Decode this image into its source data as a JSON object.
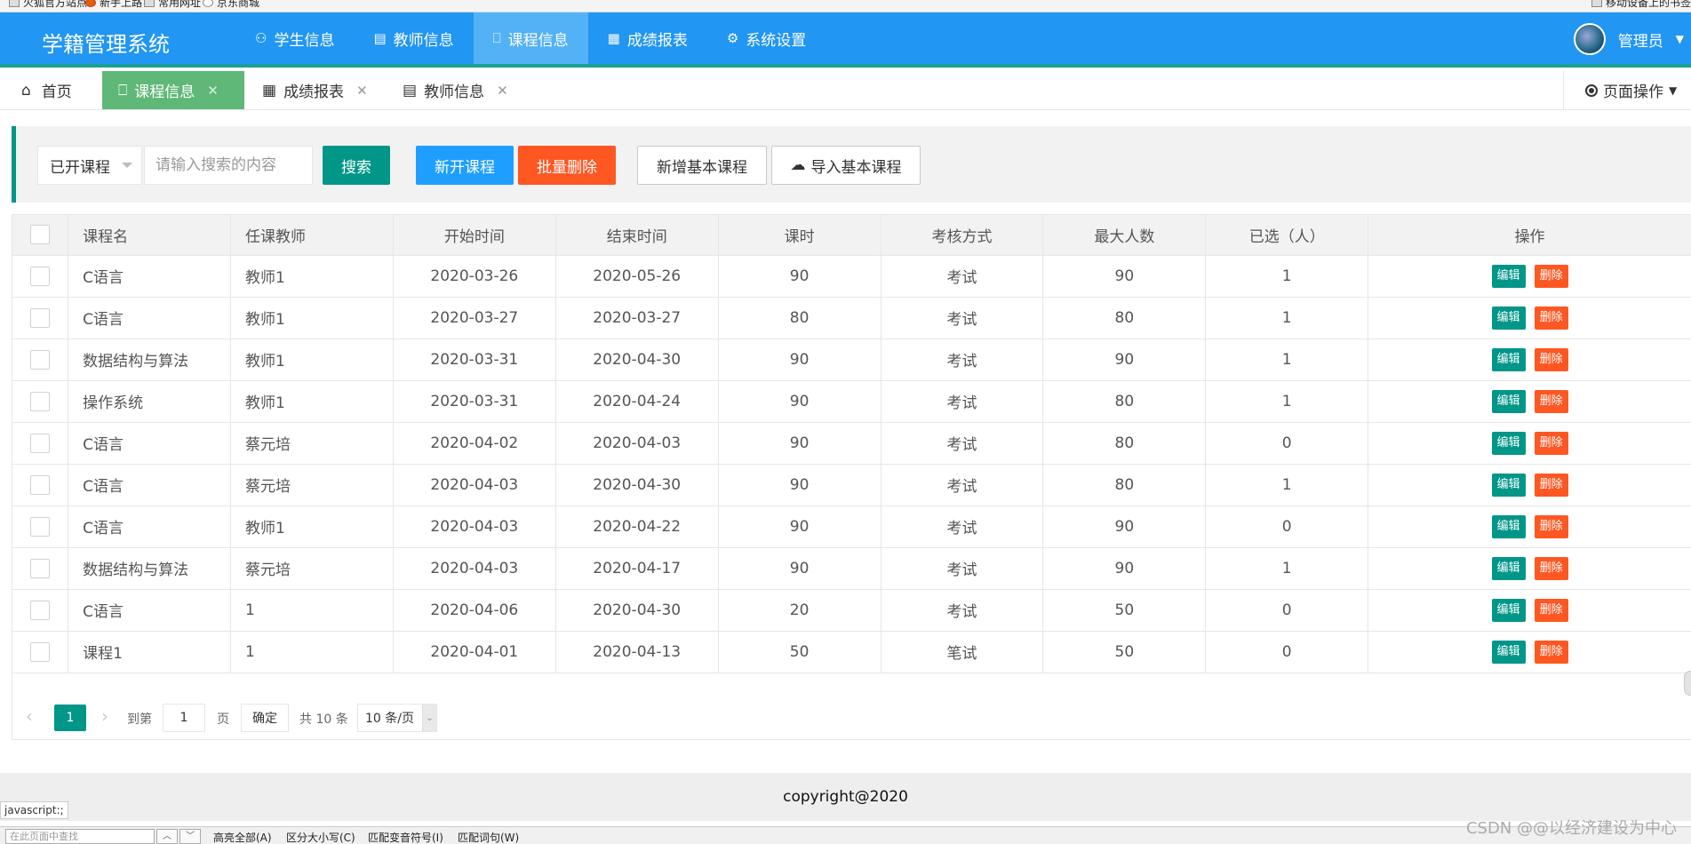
{
  "browser": {
    "bookmarks": [
      "火狐官方站点",
      "新手上路",
      "常用网址",
      "京东商城"
    ],
    "right_bookmark": "移动设备上的书签"
  },
  "header": {
    "logo": "学籍管理系统",
    "nav": [
      {
        "label": "学生信息",
        "icon": "users-icon"
      },
      {
        "label": "教师信息",
        "icon": "clipboard-icon"
      },
      {
        "label": "课程信息",
        "icon": "book-icon"
      },
      {
        "label": "成绩报表",
        "icon": "table-icon"
      },
      {
        "label": "系统设置",
        "icon": "gear-icon"
      }
    ],
    "active_nav": "课程信息",
    "user": "管理员"
  },
  "tabs": {
    "items": [
      {
        "label": "首页",
        "icon": "home-icon"
      },
      {
        "label": "课程信息",
        "icon": "book-icon"
      },
      {
        "label": "成绩报表",
        "icon": "table-icon"
      },
      {
        "label": "教师信息",
        "icon": "clipboard-icon"
      }
    ],
    "active": "课程信息",
    "page_op": "页面操作"
  },
  "toolbar": {
    "select_value": "已开课程",
    "search_placeholder": "请输入搜索的内容",
    "search_btn": "搜索",
    "new_course_btn": "新开课程",
    "batch_delete_btn": "批量删除",
    "add_basic_btn": "新增基本课程",
    "import_basic_btn": "导入基本课程"
  },
  "table": {
    "headers": [
      "课程名",
      "任课教师",
      "开始时间",
      "结束时间",
      "课时",
      "考核方式",
      "最大人数",
      "已选（人）",
      "操作"
    ],
    "rows": [
      [
        "C语言",
        "教师1",
        "2020-03-26",
        "2020-05-26",
        "90",
        "考试",
        "90",
        "1"
      ],
      [
        "C语言",
        "教师1",
        "2020-03-27",
        "2020-03-27",
        "80",
        "考试",
        "80",
        "1"
      ],
      [
        "数据结构与算法",
        "教师1",
        "2020-03-31",
        "2020-04-30",
        "90",
        "考试",
        "90",
        "1"
      ],
      [
        "操作系统",
        "教师1",
        "2020-03-31",
        "2020-04-24",
        "90",
        "考试",
        "80",
        "1"
      ],
      [
        "C语言",
        "蔡元培",
        "2020-04-02",
        "2020-04-03",
        "90",
        "考试",
        "80",
        "0"
      ],
      [
        "C语言",
        "蔡元培",
        "2020-04-03",
        "2020-04-30",
        "90",
        "考试",
        "80",
        "1"
      ],
      [
        "C语言",
        "教师1",
        "2020-04-03",
        "2020-04-22",
        "90",
        "考试",
        "90",
        "0"
      ],
      [
        "数据结构与算法",
        "蔡元培",
        "2020-04-03",
        "2020-04-17",
        "90",
        "考试",
        "90",
        "1"
      ],
      [
        "C语言",
        "1",
        "2020-04-06",
        "2020-04-30",
        "20",
        "考试",
        "50",
        "0"
      ],
      [
        "课程1",
        "1",
        "2020-04-01",
        "2020-04-13",
        "50",
        "笔试",
        "50",
        "0"
      ]
    ],
    "edit_label": "编辑",
    "delete_label": "删除"
  },
  "pager": {
    "current": "1",
    "goto_label": "到第",
    "page_input": "1",
    "page_unit": "页",
    "confirm": "确定",
    "total": "共 10 条",
    "page_size": "10 条/页"
  },
  "footer": {
    "copyright": "copyright@2020",
    "status_url": "javascript:;"
  },
  "findbar": {
    "placeholder": "在此页面中查找",
    "options": [
      "高亮全部(A)",
      "区分大小写(C)",
      "匹配变音符号(I)",
      "匹配词句(W)"
    ]
  },
  "watermark": "CSDN @@以经济建设为中心",
  "colors": {
    "header": "#2196f3",
    "teal": "#009688",
    "blue": "#1e9fff",
    "orange": "#ff5722",
    "tab_active": "#5fb878"
  }
}
